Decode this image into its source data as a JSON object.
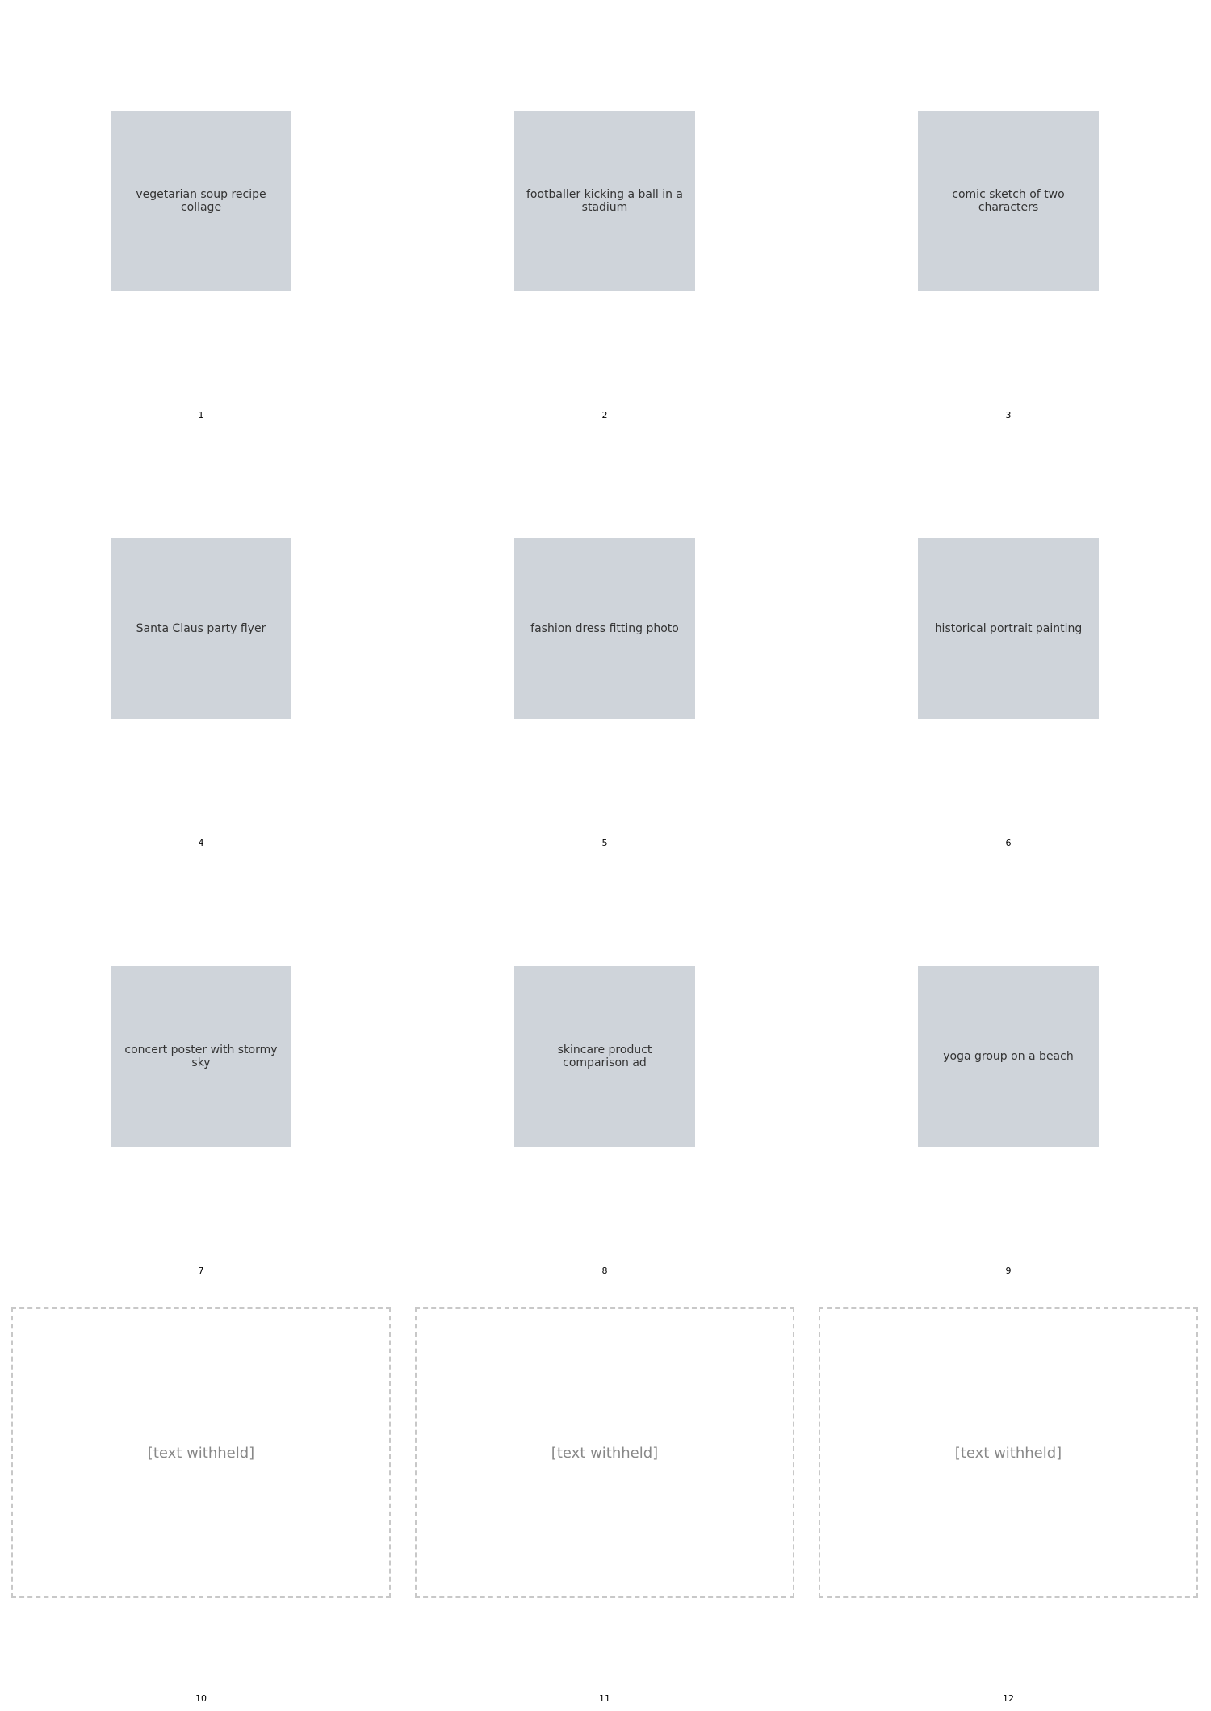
{
  "tiles": [
    {
      "number": "1",
      "image": "vegetarian soup recipe collage"
    },
    {
      "number": "2",
      "image": "footballer kicking a ball in a stadium"
    },
    {
      "number": "3",
      "image": "comic sketch of two characters"
    },
    {
      "number": "4",
      "image": "Santa Claus party flyer"
    },
    {
      "number": "5",
      "image": "fashion dress fitting photo"
    },
    {
      "number": "6",
      "image": "historical portrait painting"
    },
    {
      "number": "7",
      "image": "concert poster with stormy sky"
    },
    {
      "number": "8",
      "image": "skincare product comparison ad"
    },
    {
      "number": "9",
      "image": "yoga group on a beach"
    }
  ],
  "withheld": [
    {
      "number": "10",
      "note": "[text withheld]"
    },
    {
      "number": "11",
      "note": "[text withheld]"
    },
    {
      "number": "12",
      "note": "[text withheld]"
    }
  ]
}
